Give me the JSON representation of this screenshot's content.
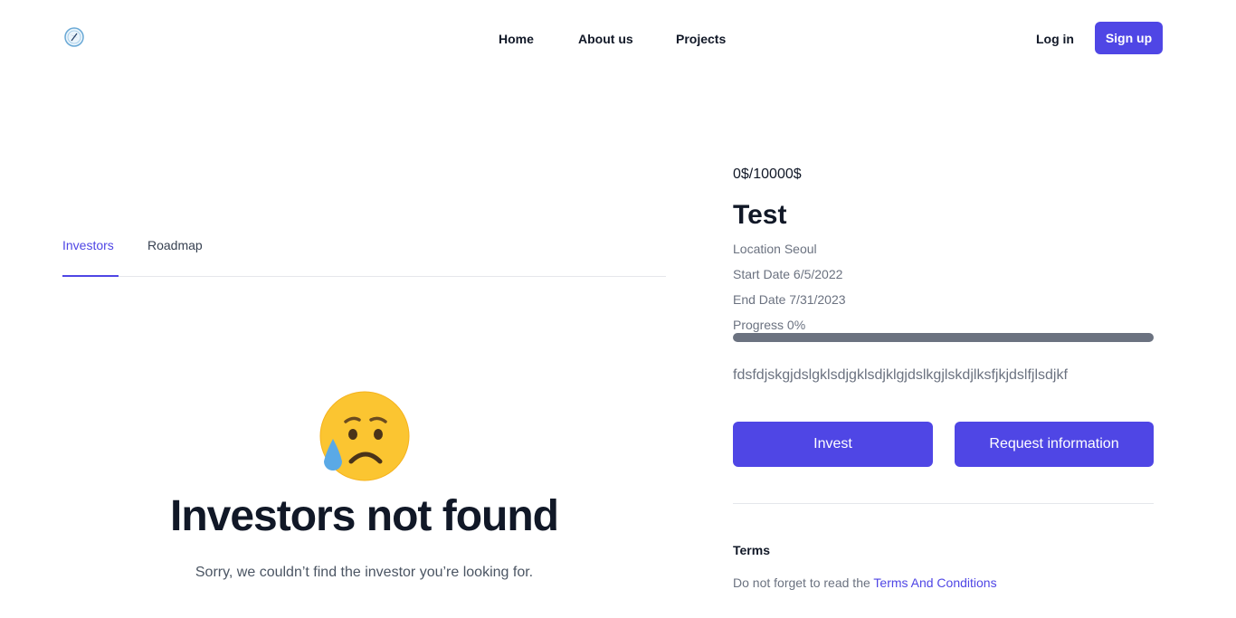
{
  "header": {
    "logo_icon": "compass-logo-icon",
    "nav": {
      "home": "Home",
      "about": "About us",
      "projects": "Projects"
    },
    "login": "Log in",
    "signup": "Sign up"
  },
  "tabs": {
    "investors": "Investors",
    "roadmap": "Roadmap",
    "active": "Investors"
  },
  "empty_state": {
    "icon": "sad-sweat-face-icon",
    "title": "Investors not found",
    "subtitle": "Sorry, we couldn’t find the investor you’re looking for."
  },
  "project": {
    "amount": "0$/10000$",
    "title": "Test",
    "location": "Location Seoul",
    "start_date": "Start Date 6/5/2022",
    "end_date": "End Date 7/31/2023",
    "progress_label": "Progress 0%",
    "progress_fraction": 0,
    "description": "fdsfdjskgjdslgklsdjgklsdjklgjdslkgjlskdjlksfjkjdslfjlsdjkf",
    "invest_button": "Invest",
    "request_button": "Request information"
  },
  "terms": {
    "heading": "Terms",
    "text": "Do not forget to read the ",
    "link": "Terms And Conditions"
  },
  "colors": {
    "accent": "#4f46e5",
    "muted_text": "#6b7280",
    "progress_track": "#6b7280"
  }
}
